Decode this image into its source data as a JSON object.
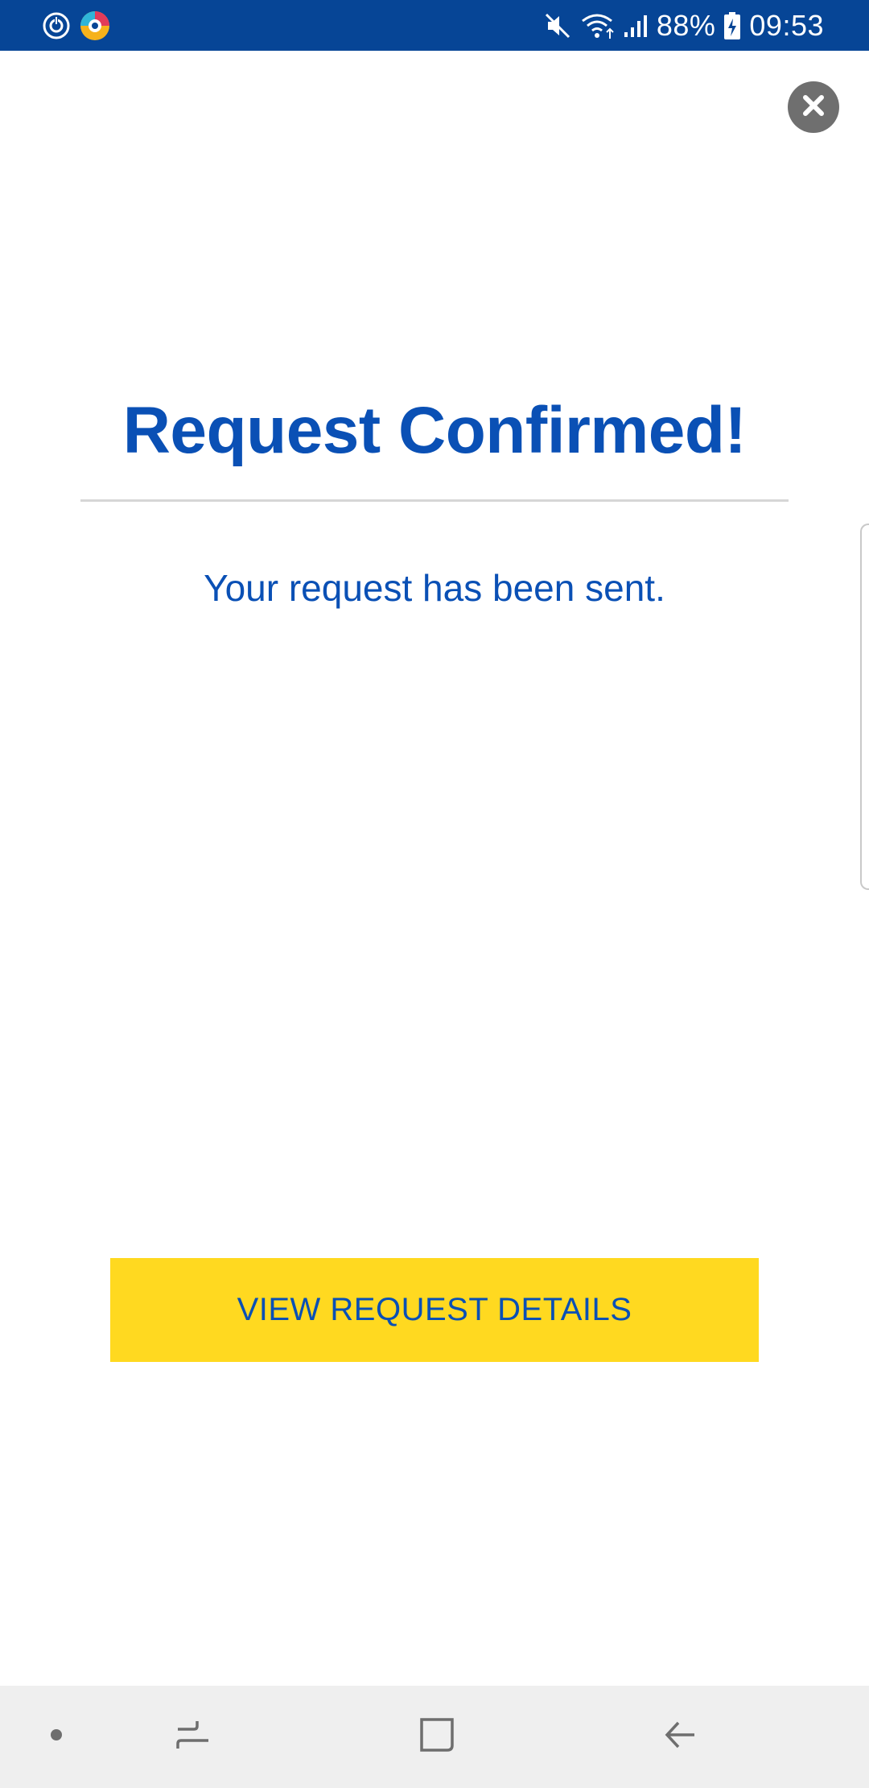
{
  "status_bar": {
    "battery": "88%",
    "time": "09:53",
    "icons": [
      "sync-icon",
      "app-notification-icon",
      "mute-icon",
      "wifi-icon",
      "signal-icon",
      "battery-charging-icon"
    ],
    "background": "#064596"
  },
  "dialog": {
    "close_icon": "close-icon",
    "title": "Request Confirmed!",
    "message": "Your request has been sent.",
    "button_label": "VIEW REQUEST DETAILS"
  },
  "colors": {
    "brand_blue": "#0a50b5",
    "button_yellow": "#ffd920",
    "divider": "#d6d6d6",
    "close_bg": "#6f6f6f",
    "nav_bg": "#efefef"
  },
  "nav_bar": {
    "icons": [
      "dot-icon",
      "recent-apps-icon",
      "home-icon",
      "back-icon"
    ]
  }
}
